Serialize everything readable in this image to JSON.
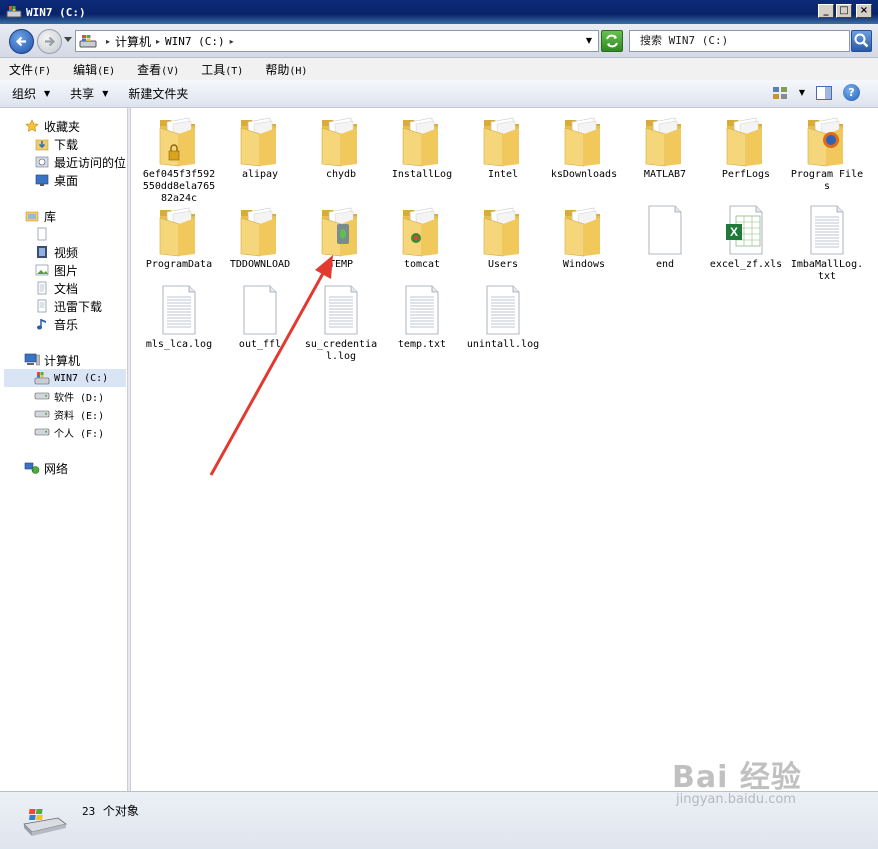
{
  "window": {
    "title": "WIN7 (C:)"
  },
  "address": {
    "crumbs": [
      {
        "label": "计算机"
      },
      {
        "label": "WIN7 (C:)"
      }
    ],
    "search_placeholder": "搜索 WIN7 (C:)"
  },
  "menu": [
    {
      "label": "文件",
      "accel": "(F)"
    },
    {
      "label": "编辑",
      "accel": "(E)"
    },
    {
      "label": "查看",
      "accel": "(V)"
    },
    {
      "label": "工具",
      "accel": "(T)"
    },
    {
      "label": "帮助",
      "accel": "(H)"
    }
  ],
  "commands": {
    "organize": "组织",
    "share": "共享",
    "new_folder": "新建文件夹"
  },
  "nav": {
    "favorites": "收藏夹",
    "fav_items": [
      "下载",
      "最近访问的位",
      "桌面"
    ],
    "libraries": "库",
    "lib_items": [
      "视频",
      "图片",
      "文档",
      "迅雷下载",
      "音乐"
    ],
    "computer": "计算机",
    "drives": [
      "WIN7 (C:)",
      "软件 (D:)",
      "资料 (E:)",
      "个人 (F:)"
    ],
    "network": "网络"
  },
  "files": [
    {
      "name": "6ef045f3f592550dd8ela76582a24c",
      "type": "folder-locked"
    },
    {
      "name": "alipay",
      "type": "folder"
    },
    {
      "name": "chydb",
      "type": "folder"
    },
    {
      "name": "InstallLog",
      "type": "folder"
    },
    {
      "name": "Intel",
      "type": "folder"
    },
    {
      "name": "ksDownloads",
      "type": "folder"
    },
    {
      "name": "MATLAB7",
      "type": "folder"
    },
    {
      "name": "PerfLogs",
      "type": "folder"
    },
    {
      "name": "Program Files",
      "type": "folder-firefox"
    },
    {
      "name": "ProgramData",
      "type": "folder"
    },
    {
      "name": "TDDOWNLOAD",
      "type": "folder"
    },
    {
      "name": "TEMP",
      "type": "folder-temp"
    },
    {
      "name": "tomcat",
      "type": "folder-tomcat"
    },
    {
      "name": "Users",
      "type": "folder"
    },
    {
      "name": "Windows",
      "type": "folder"
    },
    {
      "name": "end",
      "type": "file-blank"
    },
    {
      "name": "excel_zf.xls",
      "type": "file-excel"
    },
    {
      "name": "ImbaMallLog.txt",
      "type": "file-text"
    },
    {
      "name": "mls_lca.log",
      "type": "file-text"
    },
    {
      "name": "out_ffl",
      "type": "file-blank"
    },
    {
      "name": "su_credential.log",
      "type": "file-text"
    },
    {
      "name": "temp.txt",
      "type": "file-text"
    },
    {
      "name": "unintall.log",
      "type": "file-text"
    }
  ],
  "status": {
    "count": "23",
    "suffix": "个对象"
  },
  "watermark": {
    "big": "Bai 经验",
    "small": "jingyan.baidu.com"
  },
  "colors": {
    "annotation_arrow": "#e23a2f",
    "titlebar": "#0a246a",
    "folder": "#f2cf6b"
  }
}
